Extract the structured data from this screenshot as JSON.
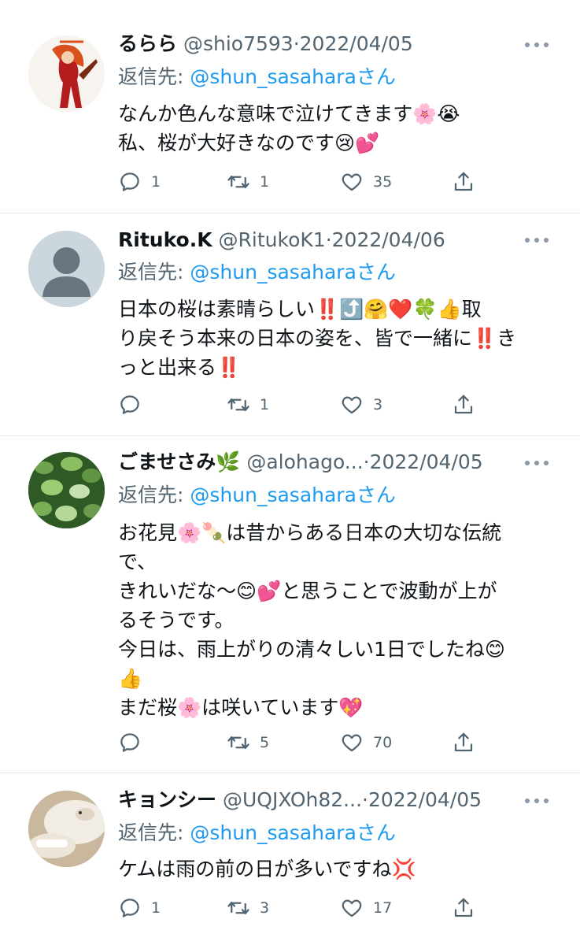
{
  "tweets": [
    {
      "name": "るらら",
      "handle": "@shio7593",
      "date": "2022/04/05",
      "reply_prefix": "返信先:",
      "reply_to": "@shun_sasahara",
      "reply_suffix": "さん",
      "lines": [
        "なんか色んな意味で泣けてきます🌸😭",
        "私、桜が大好きなのです😢💕"
      ],
      "replies": "1",
      "retweets": "1",
      "likes": "35",
      "avatar": "anime-character-avatar"
    },
    {
      "name": "Rituko.K",
      "handle": "@RitukoK1",
      "date": "2022/04/06",
      "reply_prefix": "返信先:",
      "reply_to": "@shun_sasahara",
      "reply_suffix": "さん",
      "lines": [
        "日本の桜は素晴らしい‼️⤴️🤗❤️🍀👍取",
        "り戻そう本来の日本の姿を、皆で一緒に‼️き",
        "っと出来る‼️"
      ],
      "replies": "",
      "retweets": "1",
      "likes": "3",
      "avatar": "default-avatar"
    },
    {
      "name": "ごませさみ🌿",
      "handle": "@alohago...",
      "date": "2022/04/05",
      "reply_prefix": "返信先:",
      "reply_to": "@shun_sasahara",
      "reply_suffix": "さん",
      "lines": [
        "お花見🌸🍡は昔からある日本の大切な伝統",
        "で、",
        "きれいだな〜😊💕と思うことで波動が上が",
        "るそうです。",
        "今日は、雨上がりの清々しい1日でしたね😊",
        "👍",
        "まだ桜🌸は咲いています💖"
      ],
      "replies": "",
      "retweets": "5",
      "likes": "70",
      "avatar": "plant-leaves-avatar"
    },
    {
      "name": "キョンシー",
      "handle": "@UQJXOh82...",
      "date": "2022/04/05",
      "reply_prefix": "返信先:",
      "reply_to": "@shun_sasahara",
      "reply_suffix": "さん",
      "lines": [
        "ケムは雨の前の日が多いですね💢"
      ],
      "replies": "1",
      "retweets": "3",
      "likes": "17",
      "avatar": "cat-photo-avatar"
    }
  ],
  "colors": {
    "text": "#0f1419",
    "secondary": "#536471",
    "link": "#1d9bf0",
    "divider": "#e3e6e9"
  }
}
